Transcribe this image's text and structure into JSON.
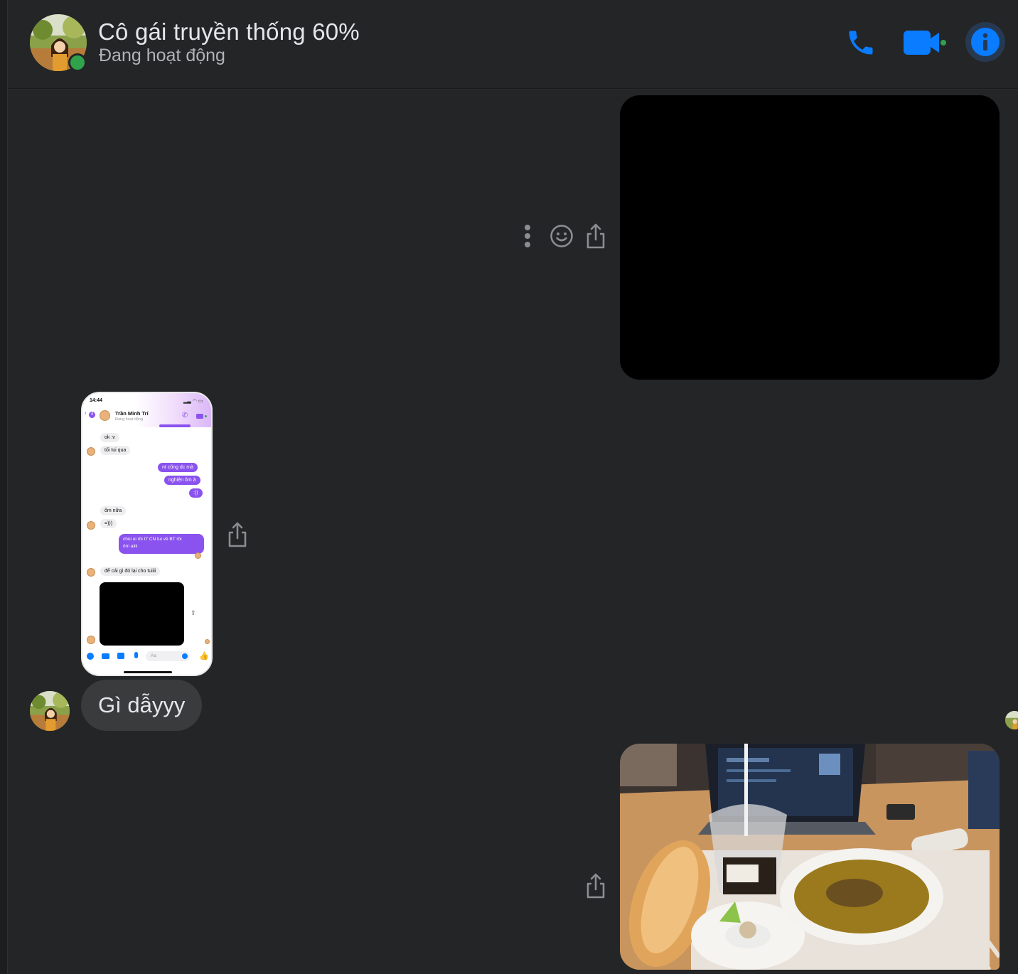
{
  "header": {
    "name": "Cô gái truyền thống 60%",
    "status": "Đang hoạt động",
    "accent_color": "#0a7cff"
  },
  "phone_screenshot": {
    "time": "14:44",
    "back_count": "4",
    "contact_name": "Trần Minh Trí",
    "contact_status": "Đang hoạt động",
    "messages": {
      "m1": "ok :v",
      "m2": "tối tui qua",
      "m3": "nt cũng dc mà",
      "m4": "nghiện ôm à",
      "m5": ":))",
      "m6": "ôm nữa",
      "m7": "=)))",
      "m8a": "chùi ui rồi t7 CN tui về BT rồi",
      "m8b": "ôm aiiii",
      "m9": "để cái gì đó lại cho tuiiii"
    },
    "input_placeholder": "Aa"
  },
  "thread": {
    "incoming_text": "Gì dẫyyy"
  },
  "icons": {
    "call": "phone-icon",
    "video": "video-camera-icon",
    "info": "info-icon",
    "more": "more-vertical-icon",
    "react": "smiley-icon",
    "share": "share-icon"
  }
}
